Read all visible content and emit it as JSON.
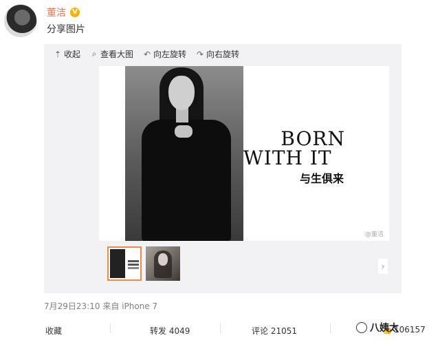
{
  "author": {
    "name": "董洁",
    "verified_badge": "V"
  },
  "post": {
    "text": "分享图片"
  },
  "toolbar": {
    "collapse": {
      "icon": "up-arrow-icon",
      "label": "收起"
    },
    "view_large": {
      "icon": "magnifier-icon",
      "label": "查看大图"
    },
    "rotate_left": {
      "icon": "rotate-left-icon",
      "label": "向左旋转"
    },
    "rotate_right": {
      "icon": "rotate-right-icon",
      "label": "向右旋转"
    }
  },
  "image": {
    "cover_title_line1": "BORN",
    "cover_title_line2": "WITH IT",
    "cover_chinese_title": "与生俱来",
    "watermark": "@董洁"
  },
  "meta": {
    "timestamp": "7月29日23:10",
    "source": "来自 iPhone 7"
  },
  "actions": {
    "favorite": "收藏",
    "repost": "转发 4049",
    "comment": "评论 21051",
    "like_count": "106157"
  },
  "corner_watermark": "八姨太",
  "colors": {
    "author_name": "#eb7350",
    "badge": "#f7b200",
    "selected_thumb_border": "#f08a47"
  }
}
